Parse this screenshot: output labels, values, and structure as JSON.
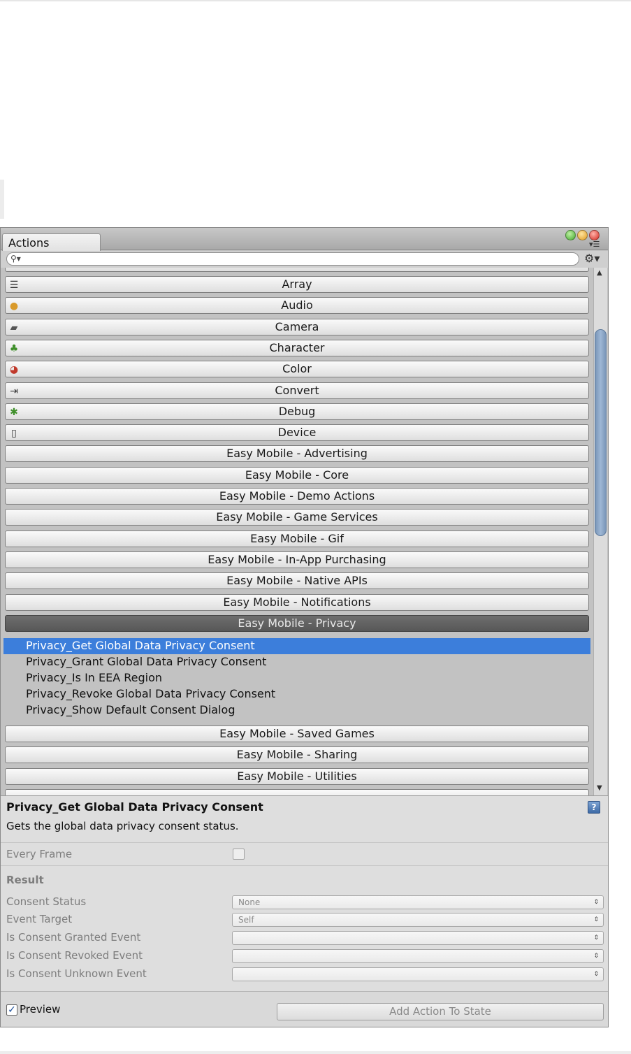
{
  "window": {
    "tab_label": "Actions",
    "search": {
      "value": "",
      "placeholder": ""
    }
  },
  "categories_top": [
    {
      "label": "Array",
      "icon": "list-icon"
    },
    {
      "label": "Audio",
      "icon": "audio-icon"
    },
    {
      "label": "Camera",
      "icon": "camera-icon"
    },
    {
      "label": "Character",
      "icon": "character-icon"
    },
    {
      "label": "Color",
      "icon": "color-wheel-icon"
    },
    {
      "label": "Convert",
      "icon": "convert-icon"
    },
    {
      "label": "Debug",
      "icon": "bug-icon"
    },
    {
      "label": "Device",
      "icon": "device-icon"
    },
    {
      "label": "Easy Mobile - Advertising"
    },
    {
      "label": "Easy Mobile - Core"
    },
    {
      "label": "Easy Mobile - Demo Actions"
    },
    {
      "label": "Easy Mobile - Game Services"
    },
    {
      "label": "Easy Mobile - Gif"
    },
    {
      "label": "Easy Mobile - In-App Purchasing"
    },
    {
      "label": "Easy Mobile - Native APIs"
    },
    {
      "label": "Easy Mobile - Notifications"
    }
  ],
  "selected_category": {
    "label": "Easy Mobile - Privacy"
  },
  "actions": [
    "Privacy_Get Global Data Privacy Consent",
    "Privacy_Grant Global Data Privacy Consent",
    "Privacy_Is In EEA Region",
    "Privacy_Revoke Global Data Privacy Consent",
    "Privacy_Show Default Consent Dialog"
  ],
  "categories_bottom": [
    {
      "label": "Easy Mobile - Saved Games"
    },
    {
      "label": "Easy Mobile - Sharing"
    },
    {
      "label": "Easy Mobile - Utilities"
    }
  ],
  "details": {
    "title": "Privacy_Get Global Data Privacy Consent",
    "description": "Gets the global data privacy consent status.",
    "help_glyph": "?",
    "every_frame_label": "Every Frame",
    "every_frame_checked": false,
    "result_heading": "Result",
    "fields": [
      {
        "label": "Consent Status",
        "value": "None"
      },
      {
        "label": "Event Target",
        "value": "Self"
      },
      {
        "label": "Is Consent Granted Event",
        "value": ""
      },
      {
        "label": "Is Consent Revoked Event",
        "value": ""
      },
      {
        "label": "Is Consent Unknown Event",
        "value": ""
      }
    ]
  },
  "footer": {
    "preview_label": "Preview",
    "preview_checked": true,
    "add_button_label": "Add Action To State"
  },
  "colors": {
    "selection_blue": "#3c7edb",
    "selected_category_bg": "#5f5f5f",
    "scroll_thumb": "#8aa6c8"
  }
}
